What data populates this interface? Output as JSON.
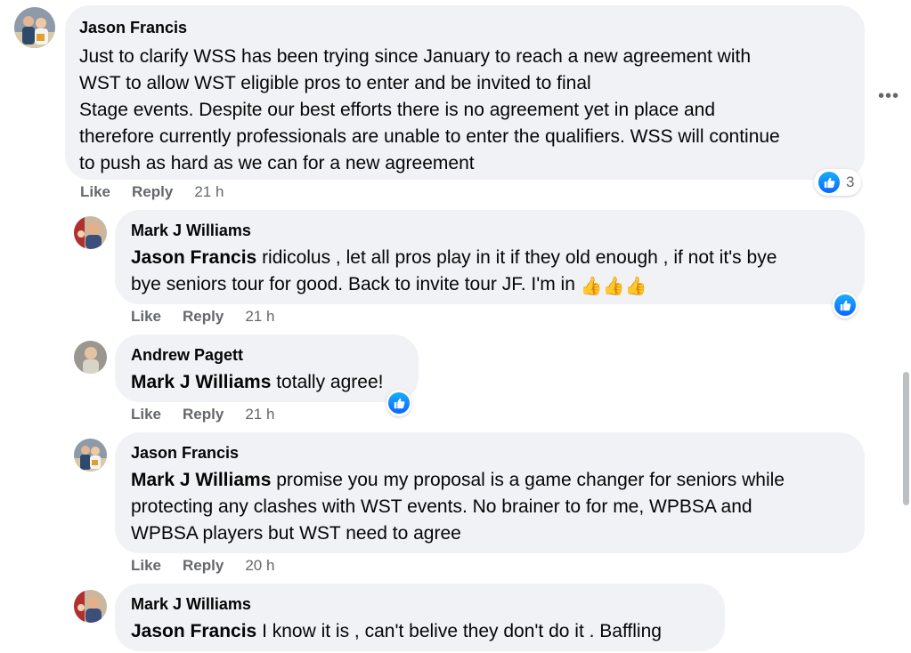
{
  "comments": [
    {
      "author": "Jason Francis",
      "text_lines": [
        "Just to clarify WSS has been trying since January to reach a new agreement with",
        "WST to allow WST eligible pros to enter and be invited to final",
        "Stage events. Despite our best efforts there is no agreement yet in place and",
        "therefore currently professionals are unable to enter the qualifiers. WSS will continue",
        "to push as hard as we can for a new agreement"
      ],
      "like_label": "Like",
      "reply_label": "Reply",
      "time": "21 h",
      "reaction_count": "3"
    },
    {
      "author": "Mark J Williams",
      "mention": "Jason Francis",
      "text_line1_rest": " ridicolus , let all pros play in it if they old enough , if not it's bye",
      "text_line2": "bye seniors tour for good. Back to invite tour JF. I'm in ",
      "emoji": "👍👍👍",
      "like_label": "Like",
      "reply_label": "Reply",
      "time": "21 h"
    },
    {
      "author": "Andrew Pagett",
      "mention": "Mark J Williams",
      "text_rest": " totally agree!",
      "like_label": "Like",
      "reply_label": "Reply",
      "time": "21 h"
    },
    {
      "author": "Jason Francis",
      "mention": "Mark J Williams",
      "text_line1_rest": " promise you my proposal is a game changer for seniors while",
      "text_line2": "protecting any clashes with WST events. No brainer to for me, WPBSA and",
      "text_line3": "WPBSA players but WST need to agree",
      "like_label": "Like",
      "reply_label": "Reply",
      "time": "20 h"
    },
    {
      "author": "Mark J Williams",
      "mention": "Jason Francis",
      "text_rest": " I know it is , can't belive they don't do it . Baffling"
    }
  ],
  "colors": {
    "bubble": "#f0f2f5",
    "meta": "#65676b",
    "like_blue": "#0866ff"
  },
  "icons": {
    "like": "thumbs-up-icon",
    "more": "more-options-icon"
  }
}
